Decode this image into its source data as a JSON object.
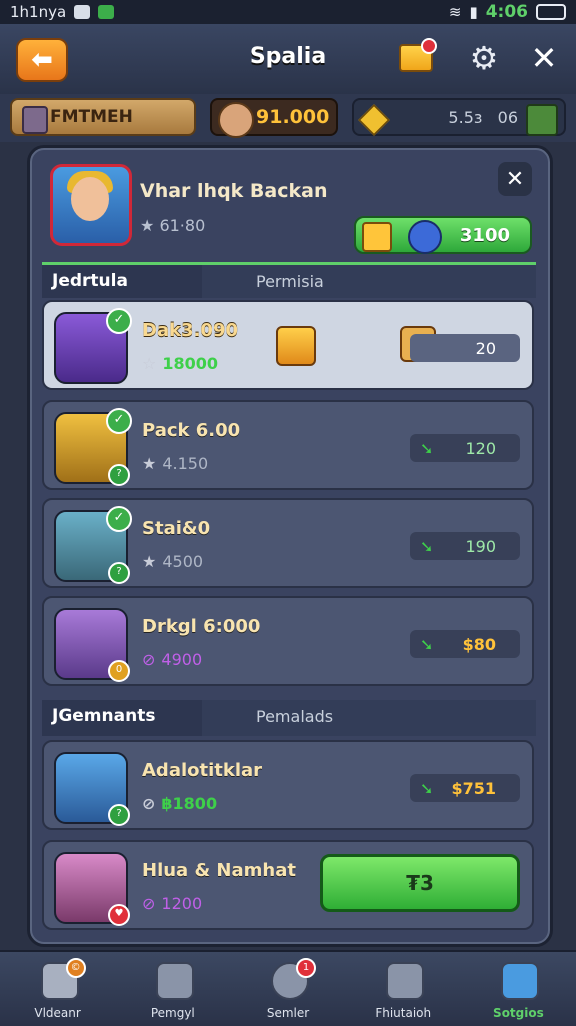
{
  "status_bar": {
    "carrier": "1h1nyа",
    "time": "4:06"
  },
  "header": {
    "title": "Spalia"
  },
  "resources": {
    "name": "FMTMEH",
    "gold": "91.000",
    "gems": "5.5з   06"
  },
  "profile": {
    "name": "Vhar lhqk Backan",
    "score": "61·80",
    "pill_value": "3100"
  },
  "section1": {
    "tab_active": "Jedrtula",
    "tab_other": "Permisia"
  },
  "section1_items": [
    {
      "title": "Dak3.090",
      "sub": "18000",
      "price": "20"
    },
    {
      "title": "Pack 6.00",
      "sub": "4.150",
      "price": "120"
    },
    {
      "title": "Stai&0",
      "sub": "4500",
      "price": "190"
    },
    {
      "title": "Drkgl 6:000",
      "sub": "4900",
      "price": "$80"
    }
  ],
  "section2": {
    "tab_active": "JGemnants",
    "tab_other": "Pemalads"
  },
  "section2_items": [
    {
      "title": "Adalotitklar",
      "sub": "฿1800",
      "price": "$751"
    },
    {
      "title": "Hlua & Namhat",
      "sub": "1200",
      "button": "₮3"
    }
  ],
  "nav": [
    {
      "label": "Vldeanr",
      "badge": "©"
    },
    {
      "label": "Pemgyl"
    },
    {
      "label": "Semler",
      "badge": "1"
    },
    {
      "label": "Fhiutaioh"
    },
    {
      "label": "Sotgios"
    }
  ],
  "colors": {
    "accent_green": "#3ed04a",
    "gold": "#ffc23a",
    "panel": "#3a4360"
  }
}
